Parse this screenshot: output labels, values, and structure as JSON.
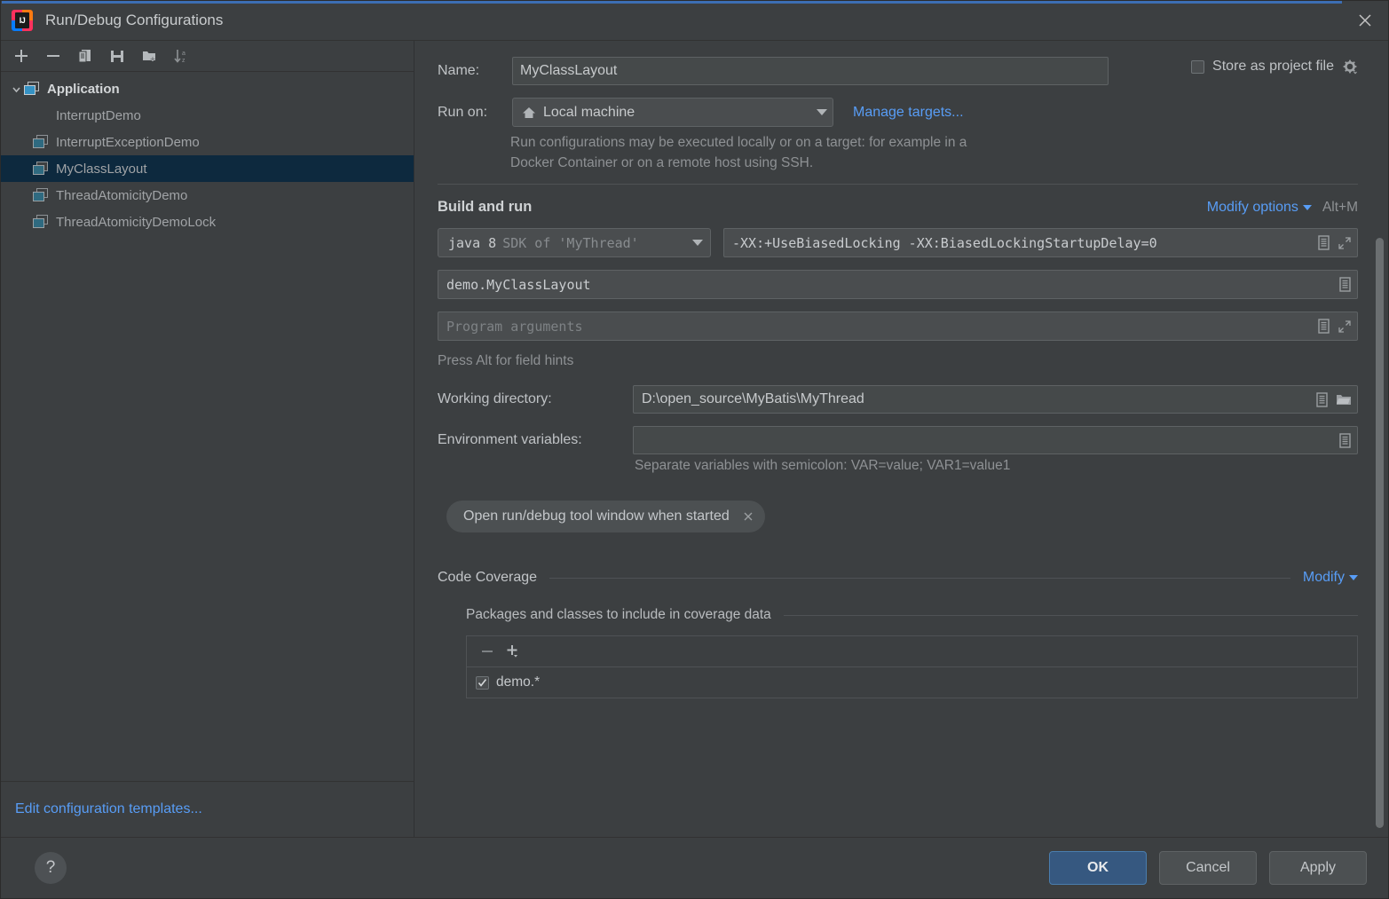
{
  "window": {
    "title": "Run/Debug Configurations",
    "logo_text": "IJ",
    "close_icon": "close-icon"
  },
  "left_panel": {
    "toolbar": [
      {
        "name": "add-configuration-button",
        "icon": "plus-icon"
      },
      {
        "name": "remove-configuration-button",
        "icon": "minus-icon"
      },
      {
        "name": "copy-configuration-button",
        "icon": "copy-icon"
      },
      {
        "name": "save-configuration-button",
        "icon": "save-icon"
      },
      {
        "name": "new-folder-button",
        "icon": "folder-add-icon"
      },
      {
        "name": "sort-configurations-button",
        "icon": "sort-alphabetically-icon"
      }
    ],
    "tree": {
      "group_label": "Application",
      "items": [
        {
          "label": "InterruptDemo",
          "has_icon": false,
          "selected": false
        },
        {
          "label": "InterruptExceptionDemo",
          "has_icon": true,
          "selected": false
        },
        {
          "label": "MyClassLayout",
          "has_icon": true,
          "selected": true
        },
        {
          "label": "ThreadAtomicityDemo",
          "has_icon": true,
          "selected": false
        },
        {
          "label": "ThreadAtomicityDemoLock",
          "has_icon": true,
          "selected": false
        }
      ]
    },
    "edit_templates_link": "Edit configuration templates..."
  },
  "form": {
    "name_label": "Name:",
    "name_value": "MyClassLayout",
    "store_as_project_file_label": "Store as project file",
    "store_as_project_file_checked": false,
    "run_on_label": "Run on:",
    "run_on_value": "Local machine",
    "manage_targets_link": "Manage targets...",
    "run_on_help": "Run configurations may be executed locally or on a target: for example in a Docker Container or on a remote host using SSH.",
    "build_and_run_title": "Build and run",
    "modify_options_link": "Modify options",
    "modify_options_shortcut": "Alt+M",
    "jdk_name": "java 8",
    "jdk_detail": "SDK of 'MyThread'",
    "vm_options_value": "-XX:+UseBiasedLocking -XX:BiasedLockingStartupDelay=0",
    "main_class_value": "demo.MyClassLayout",
    "program_arguments_placeholder": "Program arguments",
    "field_hints_text": "Press Alt for field hints",
    "working_directory_label": "Working directory:",
    "working_directory_value": "D:\\open_source\\MyBatis\\MyThread",
    "environment_variables_label": "Environment variables:",
    "environment_variables_value": "",
    "environment_variables_hint": "Separate variables with semicolon: VAR=value; VAR1=value1",
    "option_pill_label": "Open run/debug tool window when started"
  },
  "code_coverage": {
    "title": "Code Coverage",
    "modify_link": "Modify",
    "packages_title": "Packages and classes to include in coverage data",
    "toolbar": [
      {
        "name": "remove-package-button",
        "icon": "minus-icon"
      },
      {
        "name": "add-package-button",
        "icon": "plus-dropdown-icon"
      }
    ],
    "items": [
      {
        "label": "demo.*",
        "checked": true
      }
    ]
  },
  "footer": {
    "help_label": "?",
    "ok_label": "OK",
    "cancel_label": "Cancel",
    "apply_label": "Apply"
  },
  "colors": {
    "background": "#3c3f41",
    "selection": "#0d293e",
    "link": "#589df6",
    "default_button": "#365880",
    "accent_bar": "#3c6eb4"
  }
}
